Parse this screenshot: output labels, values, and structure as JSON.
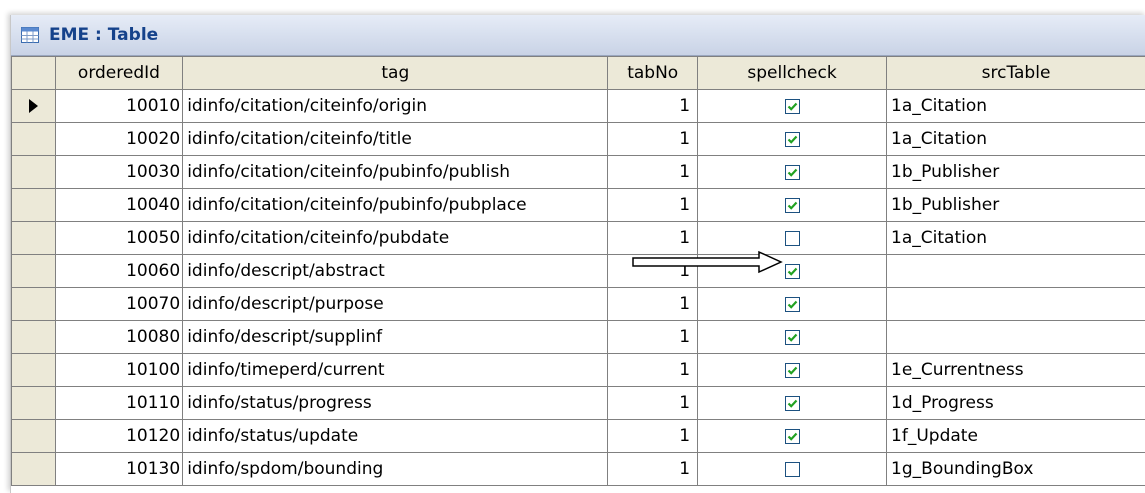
{
  "window": {
    "title": "EME : Table",
    "icon": "table-icon"
  },
  "columns": [
    "orderedId",
    "tag",
    "tabNo",
    "spellcheck",
    "srcTable"
  ],
  "rows": [
    {
      "orderedId": "10010",
      "tag": "idinfo/citation/citeinfo/origin",
      "tabNo": "1",
      "spellcheck": true,
      "srcTable": "1a_Citation",
      "current": true
    },
    {
      "orderedId": "10020",
      "tag": "idinfo/citation/citeinfo/title",
      "tabNo": "1",
      "spellcheck": true,
      "srcTable": "1a_Citation"
    },
    {
      "orderedId": "10030",
      "tag": "idinfo/citation/citeinfo/pubinfo/publish",
      "tabNo": "1",
      "spellcheck": true,
      "srcTable": "1b_Publisher"
    },
    {
      "orderedId": "10040",
      "tag": "idinfo/citation/citeinfo/pubinfo/pubplace",
      "tabNo": "1",
      "spellcheck": true,
      "srcTable": "1b_Publisher"
    },
    {
      "orderedId": "10050",
      "tag": "idinfo/citation/citeinfo/pubdate",
      "tabNo": "1",
      "spellcheck": false,
      "srcTable": "1a_Citation",
      "annotated": true
    },
    {
      "orderedId": "10060",
      "tag": "idinfo/descript/abstract",
      "tabNo": "1",
      "spellcheck": true,
      "srcTable": ""
    },
    {
      "orderedId": "10070",
      "tag": "idinfo/descript/purpose",
      "tabNo": "1",
      "spellcheck": true,
      "srcTable": ""
    },
    {
      "orderedId": "10080",
      "tag": "idinfo/descript/supplinf",
      "tabNo": "1",
      "spellcheck": true,
      "srcTable": ""
    },
    {
      "orderedId": "10100",
      "tag": "idinfo/timeperd/current",
      "tabNo": "1",
      "spellcheck": true,
      "srcTable": "1e_Currentness"
    },
    {
      "orderedId": "10110",
      "tag": "idinfo/status/progress",
      "tabNo": "1",
      "spellcheck": true,
      "srcTable": "1d_Progress"
    },
    {
      "orderedId": "10120",
      "tag": "idinfo/status/update",
      "tabNo": "1",
      "spellcheck": true,
      "srcTable": "1f_Update"
    },
    {
      "orderedId": "10130",
      "tag": "idinfo/spdom/bounding",
      "tabNo": "1",
      "spellcheck": false,
      "srcTable": "1g_BoundingBox"
    }
  ],
  "colors": {
    "checkmark": "#21a121",
    "checkbox_border": "#1c5180",
    "grid_header": "#ece9d8",
    "title_text": "#15428b"
  },
  "icons": {
    "row_pointer": "current-record-pointer-icon",
    "annotation": "annotation-arrow-icon",
    "checked": "check-icon"
  }
}
